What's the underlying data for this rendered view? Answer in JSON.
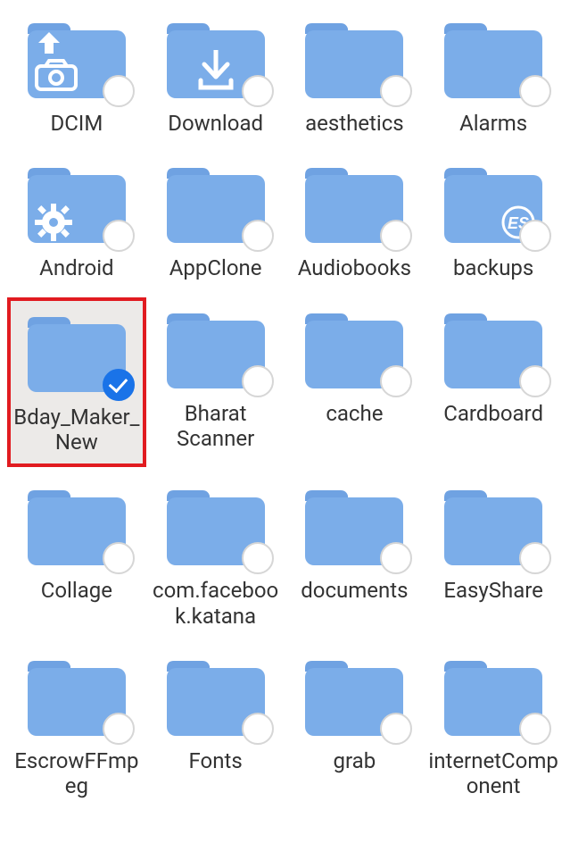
{
  "folders": [
    {
      "name": "DCIM",
      "overlay": "camera-upload",
      "selected": false,
      "highlighted": false
    },
    {
      "name": "Download",
      "overlay": "download",
      "selected": false,
      "highlighted": false
    },
    {
      "name": "aesthetics",
      "overlay": null,
      "selected": false,
      "highlighted": false
    },
    {
      "name": "Alarms",
      "overlay": null,
      "selected": false,
      "highlighted": false
    },
    {
      "name": "Android",
      "overlay": "gear",
      "selected": false,
      "highlighted": false
    },
    {
      "name": "AppClone",
      "overlay": null,
      "selected": false,
      "highlighted": false
    },
    {
      "name": "Audiobooks",
      "overlay": null,
      "selected": false,
      "highlighted": false
    },
    {
      "name": "backups",
      "overlay": "es",
      "selected": false,
      "highlighted": false
    },
    {
      "name": "Bday_Maker_New",
      "overlay": null,
      "selected": true,
      "highlighted": true
    },
    {
      "name": "Bharat Scanner",
      "overlay": null,
      "selected": false,
      "highlighted": false
    },
    {
      "name": "cache",
      "overlay": null,
      "selected": false,
      "highlighted": false
    },
    {
      "name": "Cardboard",
      "overlay": null,
      "selected": false,
      "highlighted": false
    },
    {
      "name": "Collage",
      "overlay": null,
      "selected": false,
      "highlighted": false
    },
    {
      "name": "com.facebook.katana",
      "overlay": null,
      "selected": false,
      "highlighted": false
    },
    {
      "name": "documents",
      "overlay": null,
      "selected": false,
      "highlighted": false
    },
    {
      "name": "EasyShare",
      "overlay": null,
      "selected": false,
      "highlighted": false
    },
    {
      "name": "EscrowFFmpeg",
      "overlay": null,
      "selected": false,
      "highlighted": false
    },
    {
      "name": "Fonts",
      "overlay": null,
      "selected": false,
      "highlighted": false
    },
    {
      "name": "grab",
      "overlay": null,
      "selected": false,
      "highlighted": false
    },
    {
      "name": "internetComponent",
      "overlay": null,
      "selected": false,
      "highlighted": false
    }
  ],
  "colors": {
    "folderFill": "#7bade9",
    "folderTab": "#6fa2e2",
    "highlight": "#e11b20",
    "accent": "#1a73e8"
  }
}
